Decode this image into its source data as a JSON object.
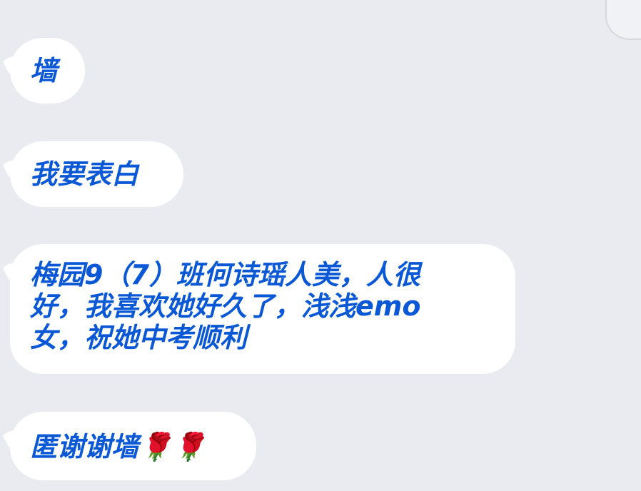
{
  "messages": [
    {
      "text": "墙"
    },
    {
      "text": "我要表白"
    },
    {
      "text": "梅园9（7）班何诗瑶人美，人很\n好，我喜欢她好久了，浅浅emo\n女，祝她中考顺利"
    },
    {
      "text": "匿谢谢墙🌹🌹"
    }
  ],
  "colors": {
    "background": "#e9ebf1",
    "bubble": "#ffffff",
    "text": "#0a58d6"
  }
}
